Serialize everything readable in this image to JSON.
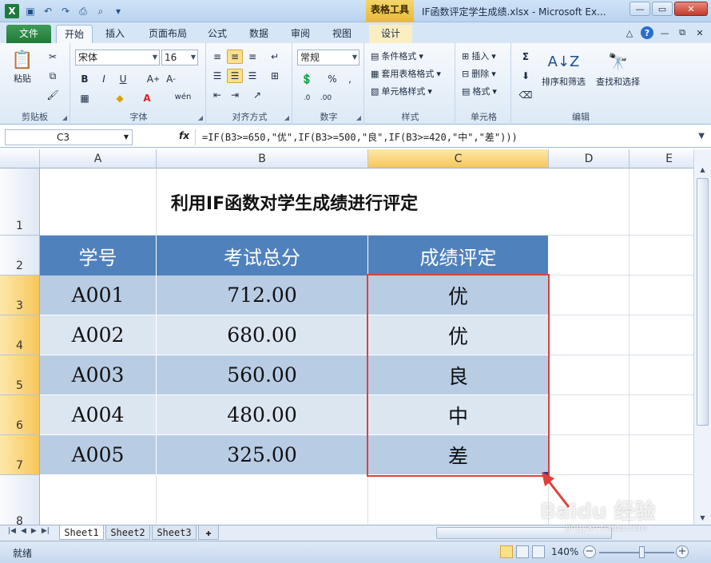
{
  "window": {
    "title": "IF函数评定学生成绩.xlsx - Microsoft Ex...",
    "context_tab": "表格工具",
    "app_icon": "X"
  },
  "tabs": {
    "file": "文件",
    "home": "开始",
    "insert": "插入",
    "page_layout": "页面布局",
    "formulas": "公式",
    "data": "数据",
    "review": "审阅",
    "view": "视图",
    "design": "设计"
  },
  "ribbon": {
    "clipboard": {
      "label": "剪贴板",
      "paste": "粘贴"
    },
    "font": {
      "label": "字体",
      "name": "宋体",
      "size": "16",
      "wen": "wén"
    },
    "alignment": {
      "label": "对齐方式"
    },
    "number": {
      "label": "数字",
      "format": "常规"
    },
    "styles": {
      "label": "样式",
      "conditional": "条件格式",
      "table": "套用表格格式",
      "cell": "单元格样式"
    },
    "cells": {
      "label": "单元格",
      "insert": "插入",
      "delete": "删除",
      "format": "格式"
    },
    "editing": {
      "label": "编辑",
      "sort": "排序和筛选",
      "find": "查找和选择"
    }
  },
  "formula_bar": {
    "name_box": "C3",
    "fx": "fx",
    "formula": "=IF(B3>=650,\"优\",IF(B3>=500,\"良\",IF(B3>=420,\"中\",\"差\")))"
  },
  "sheet": {
    "columns": [
      "A",
      "B",
      "C",
      "D",
      "E"
    ],
    "rows": [
      "1",
      "2",
      "3",
      "4",
      "5",
      "6",
      "7",
      "8"
    ],
    "title": "利用IF函数对学生成绩进行评定",
    "headers": [
      "学号",
      "考试总分",
      "成绩评定"
    ],
    "records": [
      {
        "id": "A001",
        "score": "712.00",
        "grade": "优"
      },
      {
        "id": "A002",
        "score": "680.00",
        "grade": "优"
      },
      {
        "id": "A003",
        "score": "560.00",
        "grade": "良"
      },
      {
        "id": "A004",
        "score": "480.00",
        "grade": "中"
      },
      {
        "id": "A005",
        "score": "325.00",
        "grade": "差"
      }
    ],
    "colors": {
      "header": "#4f81bd",
      "band_dark": "#b8cce4",
      "band_light": "#dce6f1",
      "selection": "#e0403a"
    }
  },
  "sheet_tabs": [
    "Sheet1",
    "Sheet2",
    "Sheet3"
  ],
  "status": {
    "mode": "就绪",
    "zoom": "140%"
  },
  "watermark": {
    "brand": "Baidu 经验",
    "url": "jingyan.baidu.com"
  }
}
